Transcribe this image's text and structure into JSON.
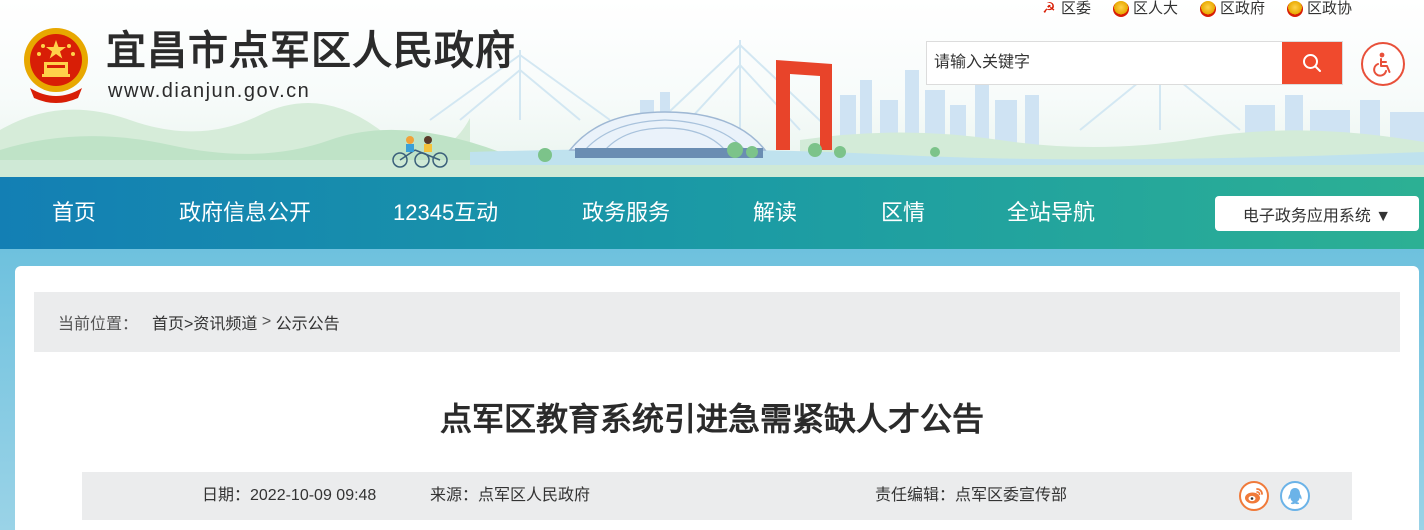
{
  "header": {
    "site_title": "宜昌市点军区人民政府",
    "site_url": "www.dianjun.gov.cn",
    "top_links": [
      {
        "label": "区委",
        "emblem": "party-emblem-icon"
      },
      {
        "label": "区人大",
        "emblem": "national-emblem-icon"
      },
      {
        "label": "区政府",
        "emblem": "national-emblem-icon"
      },
      {
        "label": "区政协",
        "emblem": "cppcc-emblem-icon"
      }
    ],
    "search": {
      "placeholder": "请输入关键字",
      "icon": "search-icon"
    },
    "accessibility_icon": "wheelchair-icon"
  },
  "nav": {
    "items": [
      {
        "label": "首页"
      },
      {
        "label": "政府信息公开"
      },
      {
        "label": "12345互动"
      },
      {
        "label": "政务服务"
      },
      {
        "label": "解读"
      },
      {
        "label": "区情"
      },
      {
        "label": "全站导航"
      }
    ],
    "select_label": "电子政务应用系统 ▼"
  },
  "breadcrumb": {
    "prefix": "当前位置：",
    "home": "首页",
    "channel": ">资讯频道",
    "sep": " > ",
    "current": "公示公告"
  },
  "article": {
    "title": "点军区教育系统引进急需紧缺人才公告",
    "date": "日期：2022-10-09 09:48",
    "source": "来源：点军区人民政府",
    "editor": "责任编辑：点军区委宣传部"
  },
  "colors": {
    "accent_red": "#f04a2d",
    "nav_start": "#137fb4",
    "nav_end": "#2cb094",
    "page_bg": "#6ec1de"
  }
}
